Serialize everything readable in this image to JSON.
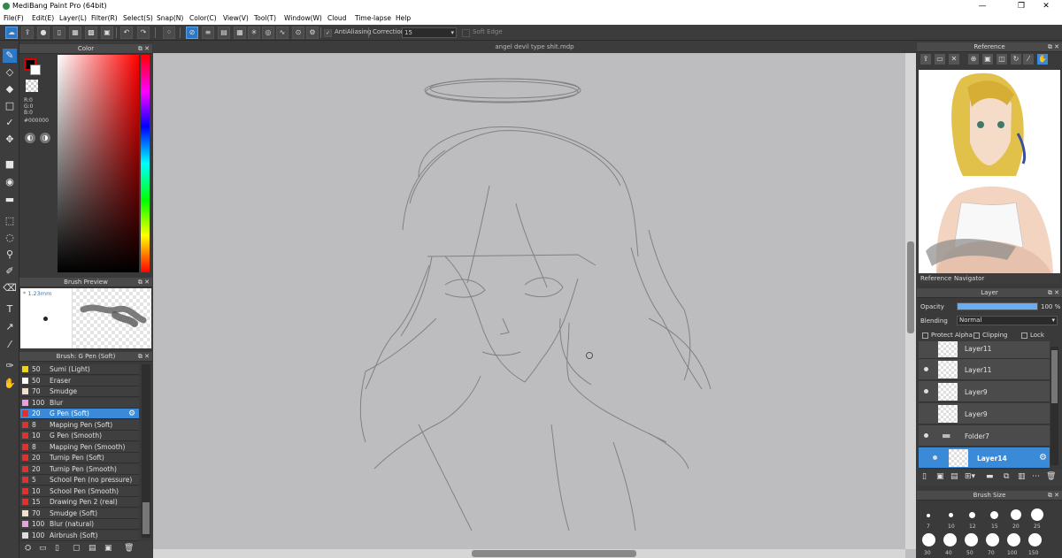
{
  "window": {
    "title": "MediBang Paint Pro (64bit)",
    "minimize": "—",
    "maximize": "❐",
    "close": "✕"
  },
  "menu": [
    "File(F)",
    "Edit(E)",
    "Layer(L)",
    "Filter(R)",
    "Select(S)",
    "Snap(N)",
    "Color(C)",
    "View(V)",
    "Tool(T)",
    "Window(W)",
    "Cloud",
    "Time-lapse",
    "Help"
  ],
  "toolbar": {
    "antialiasing": "AntiAliasing",
    "correction_label": "Correction",
    "correction_value": "15",
    "soft_edge": "Soft Edge"
  },
  "color_panel": {
    "title": "Color",
    "r": "R:0",
    "g": "G:0",
    "b": "B:0",
    "hex": "#000000"
  },
  "brush_preview": {
    "title": "Brush Preview",
    "size": "1.23mm"
  },
  "brush_panel": {
    "title": "Brush: G Pen (Soft)",
    "items": [
      {
        "size": "50",
        "name": "Sumi (Light)",
        "color": "#f1d21a"
      },
      {
        "size": "50",
        "name": "Eraser",
        "color": "#ffffff"
      },
      {
        "size": "70",
        "name": "Smudge",
        "color": "#f4e0c8"
      },
      {
        "size": "100",
        "name": "Blur",
        "color": "#e9a0e0"
      },
      {
        "size": "20",
        "name": "G Pen (Soft)",
        "color": "#e03030"
      },
      {
        "size": "8",
        "name": "Mapping Pen (Soft)",
        "color": "#e03030"
      },
      {
        "size": "10",
        "name": "G Pen (Smooth)",
        "color": "#e03030"
      },
      {
        "size": "8",
        "name": "Mapping Pen (Smooth)",
        "color": "#e03030"
      },
      {
        "size": "20",
        "name": "Turnip Pen (Soft)",
        "color": "#e03030"
      },
      {
        "size": "20",
        "name": "Turnip Pen (Smooth)",
        "color": "#e03030"
      },
      {
        "size": "5",
        "name": "School Pen (no pressure)",
        "color": "#e03030"
      },
      {
        "size": "10",
        "name": "School Pen (Smooth)",
        "color": "#e03030"
      },
      {
        "size": "15",
        "name": "Drawing Pen 2 (real)",
        "color": "#e03030"
      },
      {
        "size": "70",
        "name": "Smudge (Soft)",
        "color": "#f4e0c8"
      },
      {
        "size": "100",
        "name": "Blur (natural)",
        "color": "#e9a0e0"
      },
      {
        "size": "100",
        "name": "Airbrush (Soft)",
        "color": "#dddddd"
      }
    ]
  },
  "document": {
    "tab": "angel devil type shit.mdp"
  },
  "reference_panel": {
    "title": "Reference",
    "tab1": "Reference",
    "tab2": "Navigator"
  },
  "layer_panel": {
    "title": "Layer",
    "opacity_label": "Opacity",
    "opacity_value": "100 %",
    "opacity_percent": 100,
    "blending_label": "Blending",
    "blending_value": "Normal",
    "protect_alpha": "Protect Alpha",
    "clipping": "Clipping",
    "lock": "Lock",
    "layers": [
      "Layer11",
      "Layer11",
      "Layer9",
      "Layer9",
      "Folder7",
      "Layer14"
    ]
  },
  "brush_size_panel": {
    "title": "Brush Size",
    "sizes_row1": [
      "7",
      "10",
      "12",
      "15",
      "20",
      "25"
    ],
    "sizes_row2": [
      "30",
      "40",
      "50",
      "70",
      "100",
      "150"
    ]
  }
}
